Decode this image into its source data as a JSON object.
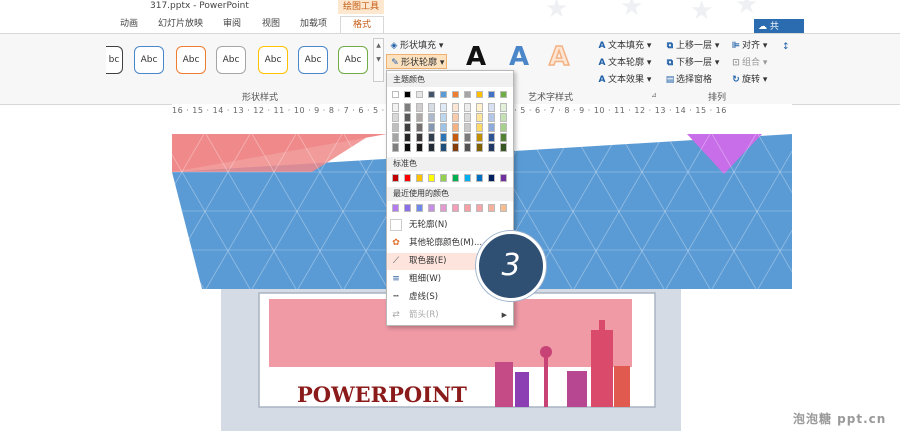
{
  "window": {
    "title": "317.pptx - PowerPoint",
    "context_tab_group": "绘图工具",
    "share_label": "共"
  },
  "tabs": [
    "动画",
    "幻灯片放映",
    "审阅",
    "视图",
    "加载项",
    "格式"
  ],
  "ribbon": {
    "shape_style_label": "Abc",
    "shape_style_colors": [
      "#404040",
      "#4a86c8",
      "#ed7d31",
      "#a5a5a5",
      "#ffc000",
      "#4a86c8",
      "#70ad47"
    ],
    "shape_fill_label": "形状填充",
    "shape_outline_label": "形状轮廓",
    "wordart_sample": "A",
    "wordart_colors": [
      "#111111",
      "#4a86c8",
      "#f4b183"
    ],
    "text_fill_label": "文本填充",
    "text_outline_label": "文本轮廓",
    "text_effect_label": "文本效果",
    "bring_forward_label": "上移一层",
    "send_backward_label": "下移一层",
    "selection_pane_label": "选择窗格",
    "align_label": "对齐",
    "group_label": "组合",
    "rotate_label": "旋转",
    "group_shape_styles": "形状样式",
    "group_wordart": "艺术字样式",
    "group_arrange": "排列"
  },
  "ruler_text": "16 · 15 · 14 · 13 · 12 · 11 · 10 · 9 · 8 · 7 · 6 · 5 · 4 · 3 · 2 · 1 · 0 · 1 · 2 · 3 · 4 · 5 · 6 · 7 · 8 · 9 · 10 · 11 · 12 · 13 · 14 · 15 · 16",
  "outline_menu": {
    "theme_colors_header": "主题颜色",
    "standard_colors_header": "标准色",
    "recent_colors_header": "最近使用的颜色",
    "theme_top_row": [
      "#ffffff",
      "#000000",
      "#e7e6e6",
      "#44546a",
      "#5b9bd5",
      "#ed7d31",
      "#a5a5a5",
      "#ffc000",
      "#4472c4",
      "#70ad47"
    ],
    "theme_shade_rows": [
      [
        "#f2f2f2",
        "#7f7f7f",
        "#d0cece",
        "#d6dce4",
        "#deebf6",
        "#fbe5d5",
        "#ededed",
        "#fff2cc",
        "#d9e2f3",
        "#e2efd9"
      ],
      [
        "#d8d8d8",
        "#595959",
        "#aeaaaa",
        "#adb9ca",
        "#bdd7ee",
        "#f7cbac",
        "#dbdbdb",
        "#fee599",
        "#b4c6e7",
        "#c5e0b3"
      ],
      [
        "#bfbfbf",
        "#3f3f3f",
        "#757070",
        "#8496b0",
        "#9dc3e6",
        "#f4b183",
        "#c9c9c9",
        "#ffd965",
        "#8eaadb",
        "#a8d08d"
      ],
      [
        "#a5a5a5",
        "#262626",
        "#3a3838",
        "#323f4f",
        "#2e75b5",
        "#c55a11",
        "#7b7b7b",
        "#bf8f00",
        "#2f5496",
        "#538135"
      ],
      [
        "#7f7f7f",
        "#0c0c0c",
        "#171616",
        "#222a35",
        "#1e4e79",
        "#843c0b",
        "#525252",
        "#7f6000",
        "#1f3864",
        "#375623"
      ]
    ],
    "standard_colors": [
      "#c00000",
      "#ff0000",
      "#ffc000",
      "#ffff00",
      "#92d050",
      "#00b050",
      "#00b0f0",
      "#0070c0",
      "#002060",
      "#7030a0"
    ],
    "recent_colors": [
      "#b57bee",
      "#8c6ee6",
      "#6f8ae8",
      "#c58fe3",
      "#e29ad1",
      "#f3a1b8",
      "#f6a0a6",
      "#f4a6ab",
      "#f6b09e",
      "#f7bd92"
    ],
    "items": [
      {
        "label": "无轮廓(N)",
        "icon": "no-outline-icon"
      },
      {
        "label": "其他轮廓颜色(M)...",
        "icon": "color-wheel-icon"
      },
      {
        "label": "取色器(E)",
        "icon": "eyedropper-icon"
      },
      {
        "label": "粗细(W)",
        "icon": "weight-icon"
      },
      {
        "label": "虚线(S)",
        "icon": "dashes-icon"
      },
      {
        "label": "箭头(R)",
        "icon": "arrows-icon"
      }
    ]
  },
  "slide": {
    "thumb_title": "POWERPOINT",
    "colors": {
      "blue": "#5b9bd5",
      "pink": "#f08a8a",
      "magenta": "#c86ee8",
      "title_red": "#8b1a1a"
    }
  },
  "step_badge": "3",
  "watermark": "泡泡糖 ppt.cn"
}
